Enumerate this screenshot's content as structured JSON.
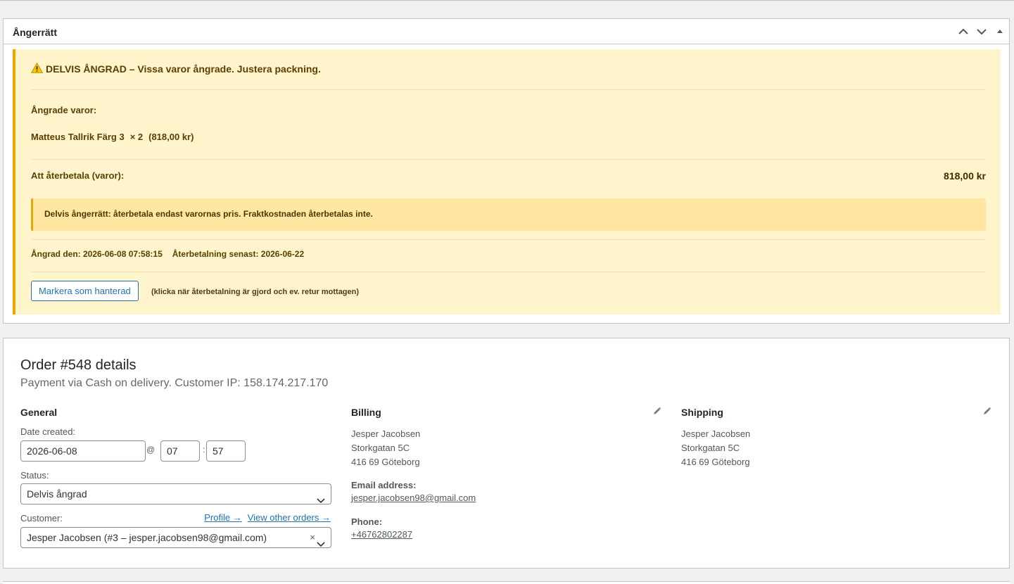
{
  "withdrawal": {
    "title": "Ångerrätt",
    "status_line": "DELVIS ÅNGRAD – Vissa varor ångrade. Justera packning.",
    "items_label": "Ångrade varor:",
    "items": [
      {
        "name": "Matteus Tallrik Färg 3",
        "qty": "× 2",
        "price": "(818,00 kr)"
      }
    ],
    "refund_label": "Att återbetala (varor):",
    "refund_amount": "818,00 kr",
    "note": "Delvis ångerrätt: återbetala endast varornas pris. Fraktkostnaden återbetalas inte.",
    "withdrawn_on": "Ångrad den: 2026-06-08 07:58:15",
    "refund_by": "Återbetalning senast: 2026-06-22",
    "mark_button": "Markera som hanterad",
    "mark_hint": "(klicka när återbetalning är gjord och ev. retur mottagen)",
    "accent_color": "#f0a500",
    "bg_color": "#fff4cc",
    "icons": {
      "warning": "warning-icon",
      "up": "chevron-up-icon",
      "down": "chevron-down-icon",
      "toggle": "triangle-up-icon"
    }
  },
  "order": {
    "title": "Order #548 details",
    "subtitle": "Payment via Cash on delivery. Customer IP: 158.174.217.170",
    "general": {
      "heading": "General",
      "date_label": "Date created:",
      "date": "2026-06-08",
      "at": "@",
      "hour": "07",
      "colon": ":",
      "minute": "57",
      "status_label": "Status:",
      "status": "Delvis ångrad",
      "customer_label": "Customer:",
      "profile_link": "Profile →",
      "orders_link": "View other orders →",
      "customer": "Jesper Jacobsen (#3 – jesper.jacobsen98@gmail.com)",
      "clear": "×"
    },
    "billing": {
      "heading": "Billing",
      "name": "Jesper Jacobsen",
      "street": "Storkgatan 5C",
      "city": "416 69 Göteborg",
      "email_label": "Email address:",
      "email": "jesper.jacobsen98@gmail.com",
      "phone_label": "Phone:",
      "phone": "+46762802287"
    },
    "shipping": {
      "heading": "Shipping",
      "name": "Jesper Jacobsen",
      "street": "Storkgatan 5C",
      "city": "416 69 Göteborg"
    }
  }
}
